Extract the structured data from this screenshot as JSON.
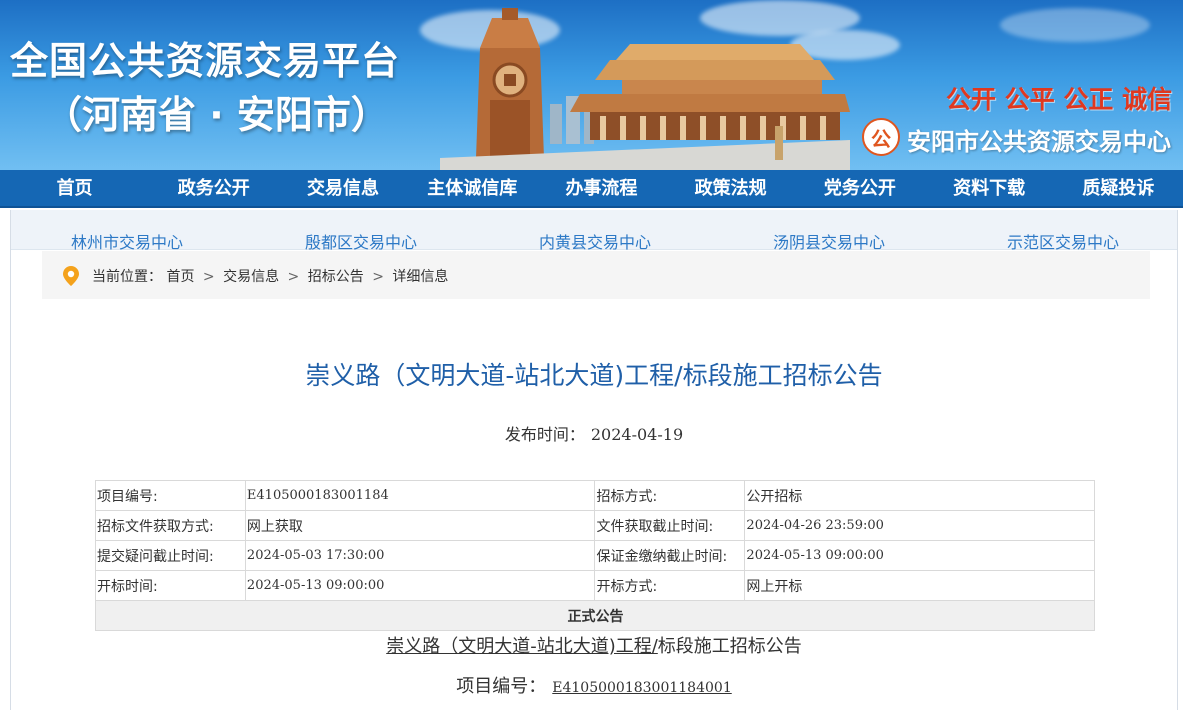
{
  "banner": {
    "title": "全国公共资源交易平台",
    "subtitle": "（河南省 · 安阳市）",
    "slogan": "公开 公平 公正 诚信",
    "center_name": "安阳市公共资源交易中心",
    "colors": {
      "sky": "#1d6fc4",
      "slogan": "#e0381f"
    }
  },
  "nav": {
    "items": [
      "首页",
      "政务公开",
      "交易信息",
      "主体诚信库",
      "办事流程",
      "政策法规",
      "党务公开",
      "资料下载",
      "质疑投诉"
    ],
    "color": "#1567b4"
  },
  "subsites": [
    "林州市交易中心",
    "殷都区交易中心",
    "内黄县交易中心",
    "汤阴县交易中心",
    "示范区交易中心"
  ],
  "breadcrumb": {
    "prefix": "当前位置：",
    "items": [
      "首页",
      "交易信息",
      "招标公告",
      "详细信息"
    ],
    "separator": ">"
  },
  "article": {
    "title": "崇义路（文明大道-站北大道)工程/标段施工招标公告",
    "publish_label": "发布时间：",
    "publish_date": "2024-04-19"
  },
  "info_table": {
    "rows": [
      [
        "项目编号:",
        "E4105000183001184",
        "招标方式:",
        "公开招标"
      ],
      [
        "招标文件获取方式:",
        "网上获取",
        "文件获取截止时间:",
        "2024-04-26 23:59:00"
      ],
      [
        "提交疑问截止时间:",
        "2024-05-03 17:30:00",
        "保证金缴纳截止时间:",
        "2024-05-13 09:00:00"
      ],
      [
        "开标时间:",
        "2024-05-13 09:00:00",
        "开标方式:",
        "网上开标"
      ]
    ],
    "official_label": "正式公告"
  },
  "doc": {
    "heading_underlined": "崇义路（文明大道-站北大道)工程/",
    "heading_rest": "标段施工招标公告",
    "code_label": "项目编号：",
    "code_value": "E4105000183001184001"
  }
}
